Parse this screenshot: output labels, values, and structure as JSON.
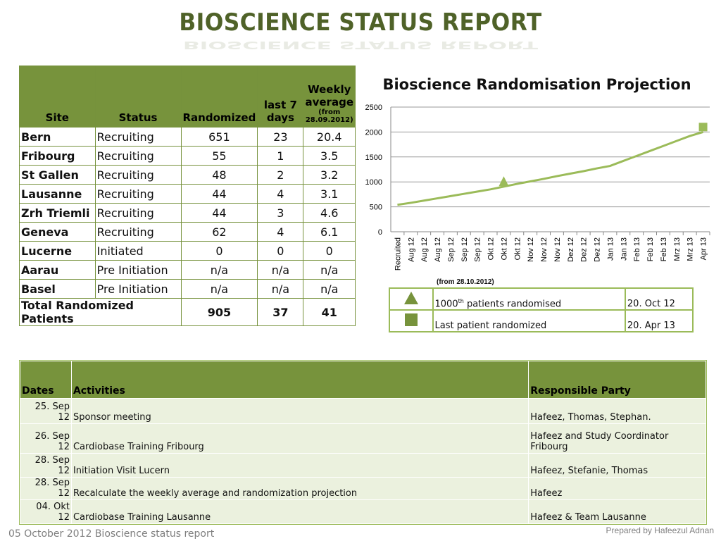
{
  "title": "BIOSCIENCE STATUS REPORT",
  "sites_table": {
    "headers": {
      "site": "Site",
      "status": "Status",
      "randomized": "Randomized",
      "last7": "last 7 days",
      "weekly_line1": "Weekly average",
      "weekly_line2": "(from 28.09.2012)"
    },
    "rows": [
      {
        "site": "Bern",
        "status": "Recruiting",
        "randomized": "651",
        "last7": "23",
        "weekly": "20.4"
      },
      {
        "site": "Fribourg",
        "status": "Recruiting",
        "randomized": "55",
        "last7": "1",
        "weekly": "3.5"
      },
      {
        "site": "St Gallen",
        "status": "Recruiting",
        "randomized": "48",
        "last7": "2",
        "weekly": "3.2"
      },
      {
        "site": "Lausanne",
        "status": "Recruiting",
        "randomized": "44",
        "last7": "4",
        "weekly": "3.1"
      },
      {
        "site": "Zrh Triemli",
        "status": "Recruiting",
        "randomized": "44",
        "last7": "3",
        "weekly": "4.6"
      },
      {
        "site": "Geneva",
        "status": "Recruiting",
        "randomized": "62",
        "last7": "4",
        "weekly": "6.1"
      },
      {
        "site": "Lucerne",
        "status": "Initiated",
        "randomized": "0",
        "last7": "0",
        "weekly": "0"
      },
      {
        "site": "Aarau",
        "status": "Pre Initiation",
        "randomized": "n/a",
        "last7": "n/a",
        "weekly": "n/a"
      },
      {
        "site": "Basel",
        "status": "Pre Initiation",
        "randomized": "n/a",
        "last7": "n/a",
        "weekly": "n/a"
      }
    ],
    "total": {
      "label": "Total Randomized Patients",
      "randomized": "905",
      "last7": "37",
      "weekly": "41"
    }
  },
  "chart_data": {
    "type": "line",
    "title": "Bioscience Randomisation Projection",
    "categories": [
      "Recruited",
      "Aug 12",
      "Aug 12",
      "Aug 12",
      "Sep 12",
      "Sep 12",
      "Sep 12",
      "Okt 12",
      "Okt 12",
      "Okt 12",
      "Nov 12",
      "Nov 12",
      "Nov 12",
      "Dez 12",
      "Dez 12",
      "Dez 12",
      "Jan 13",
      "Jan 13",
      "Feb 13",
      "Feb 13",
      "Feb 13",
      "Mrz 13",
      "Mrz 13",
      "Apr 13"
    ],
    "values": [
      540,
      580,
      625,
      670,
      715,
      760,
      805,
      850,
      905,
      960,
      1010,
      1060,
      1115,
      1165,
      1215,
      1270,
      1320,
      1420,
      1520,
      1620,
      1720,
      1820,
      1920,
      2000
    ],
    "ylim": [
      0,
      2500
    ],
    "yticks": [
      0,
      500,
      1000,
      1500,
      2000,
      2500
    ],
    "grid": true,
    "color": "#9bbb59",
    "note": "(from 28.10.2012)",
    "markers": [
      {
        "shape": "triangle",
        "category_index": 8,
        "value": 1000
      },
      {
        "shape": "square",
        "category_index": 23,
        "value": 2100
      }
    ]
  },
  "milestones": [
    {
      "icon": "triangle-icon",
      "text_pre": "1000",
      "text_sup": "th",
      "text_post": " patients randomised",
      "date": "20. Oct  12"
    },
    {
      "icon": "square-icon",
      "text_pre": "Last patient randomized",
      "text_sup": "",
      "text_post": "",
      "date": "20. Apr 13"
    }
  ],
  "activities": {
    "headers": {
      "dates": "Dates",
      "activities": "Activities",
      "party": "Responsible Party"
    },
    "rows": [
      {
        "date": "25. Sep 12",
        "activity": "Sponsor meeting",
        "party": "Hafeez, Thomas, Stephan."
      },
      {
        "date": "26. Sep 12",
        "activity": "Cardiobase Training Fribourg",
        "party": "Hafeez and Study Coordinator Fribourg"
      },
      {
        "date": "28. Sep 12",
        "activity": "Initiation Visit Lucern",
        "party": "Hafeez, Stefanie, Thomas"
      },
      {
        "date": "28. Sep 12",
        "activity": "Recalculate the weekly average and randomization projection",
        "party": "Hafeez"
      },
      {
        "date": "04. Okt 12",
        "activity": "Cardiobase Training Lausanne",
        "party": "Hafeez & Team Lausanne"
      }
    ]
  },
  "footer": {
    "left": "05 October 2012  Bioscience status report",
    "right": "Prepared by Hafeezul Adnan"
  },
  "colors": {
    "header_green": "#77933c",
    "line_green": "#9bbb59",
    "title_green": "#4f6228",
    "row_fill": "#ebf1de"
  }
}
